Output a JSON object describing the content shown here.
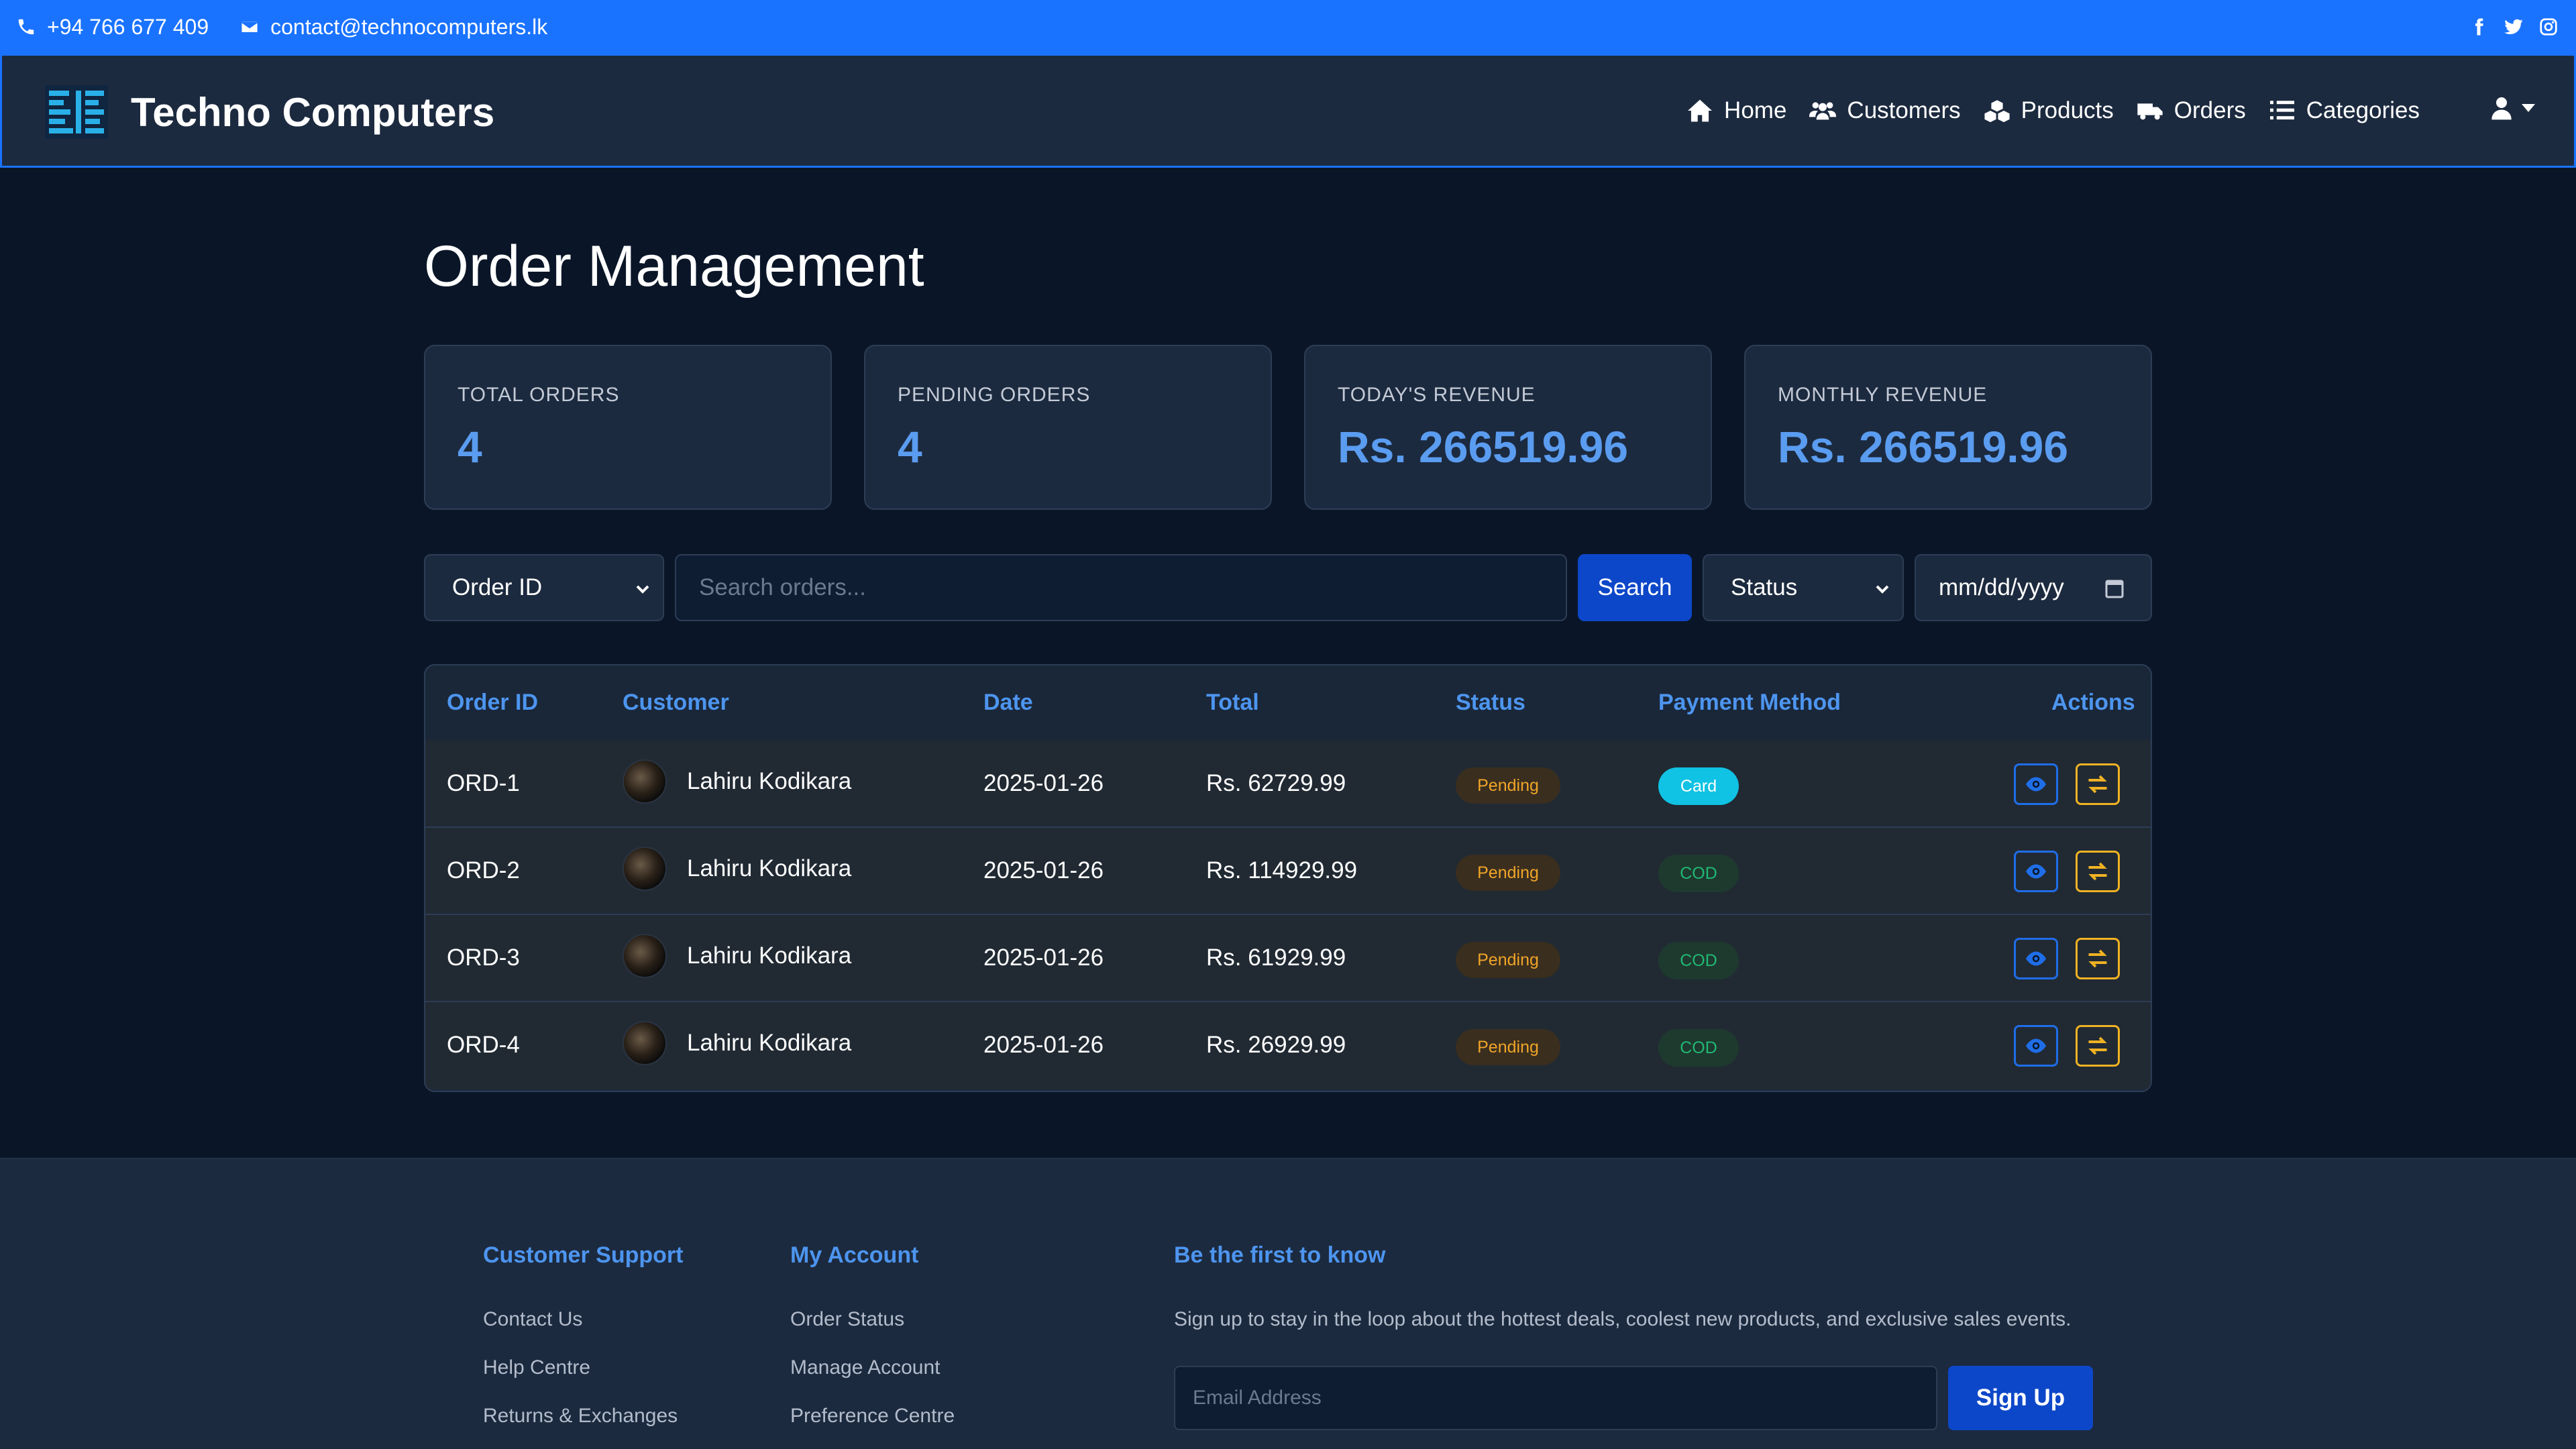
{
  "topbar": {
    "phone": "+94 766 677 409",
    "email": "contact@technocomputers.lk",
    "social_icons": [
      "facebook-icon",
      "twitter-icon",
      "instagram-icon"
    ]
  },
  "brand": {
    "name": "Techno Computers"
  },
  "nav": {
    "items": [
      {
        "label": "Home",
        "icon": "home-icon"
      },
      {
        "label": "Customers",
        "icon": "users-icon"
      },
      {
        "label": "Products",
        "icon": "cubes-icon"
      },
      {
        "label": "Orders",
        "icon": "truck-icon"
      },
      {
        "label": "Categories",
        "icon": "list-icon"
      }
    ],
    "user_icon": "user-icon"
  },
  "page": {
    "title": "Order Management"
  },
  "stats": [
    {
      "label": "TOTAL ORDERS",
      "value": "4"
    },
    {
      "label": "PENDING ORDERS",
      "value": "4"
    },
    {
      "label": "TODAY'S REVENUE",
      "value": "Rs. 266519.96"
    },
    {
      "label": "MONTHLY REVENUE",
      "value": "Rs. 266519.96"
    }
  ],
  "filters": {
    "search_by": "Order ID",
    "search_placeholder": "Search orders...",
    "search_button": "Search",
    "status": "Status",
    "date_placeholder": "mm/dd/yyyy"
  },
  "table": {
    "headers": [
      "Order ID",
      "Customer",
      "Date",
      "Total",
      "Status",
      "Payment Method",
      "Actions"
    ],
    "rows": [
      {
        "id": "ORD-1",
        "customer": "Lahiru Kodikara",
        "date": "2025-01-26",
        "total": "Rs. 62729.99",
        "status": "Pending",
        "payment": "Card"
      },
      {
        "id": "ORD-2",
        "customer": "Lahiru Kodikara",
        "date": "2025-01-26",
        "total": "Rs. 114929.99",
        "status": "Pending",
        "payment": "COD"
      },
      {
        "id": "ORD-3",
        "customer": "Lahiru Kodikara",
        "date": "2025-01-26",
        "total": "Rs. 61929.99",
        "status": "Pending",
        "payment": "COD"
      },
      {
        "id": "ORD-4",
        "customer": "Lahiru Kodikara",
        "date": "2025-01-26",
        "total": "Rs. 26929.99",
        "status": "Pending",
        "payment": "COD"
      }
    ]
  },
  "footer": {
    "support": {
      "title": "Customer Support",
      "links": [
        "Contact Us",
        "Help Centre",
        "Returns & Exchanges"
      ]
    },
    "account": {
      "title": "My Account",
      "links": [
        "Order Status",
        "Manage Account",
        "Preference Centre"
      ]
    },
    "newsletter": {
      "title": "Be the first to know",
      "description": "Sign up to stay in the loop about the hottest deals, coolest new products, and exclusive sales events.",
      "email_placeholder": "Email Address",
      "button": "Sign Up"
    }
  },
  "colors": {
    "accent": "#1a73ff",
    "stat_value": "#5a9cf0",
    "pending": "#f0a528",
    "card_badge": "#10c2e4",
    "cod_badge": "#20b874"
  }
}
